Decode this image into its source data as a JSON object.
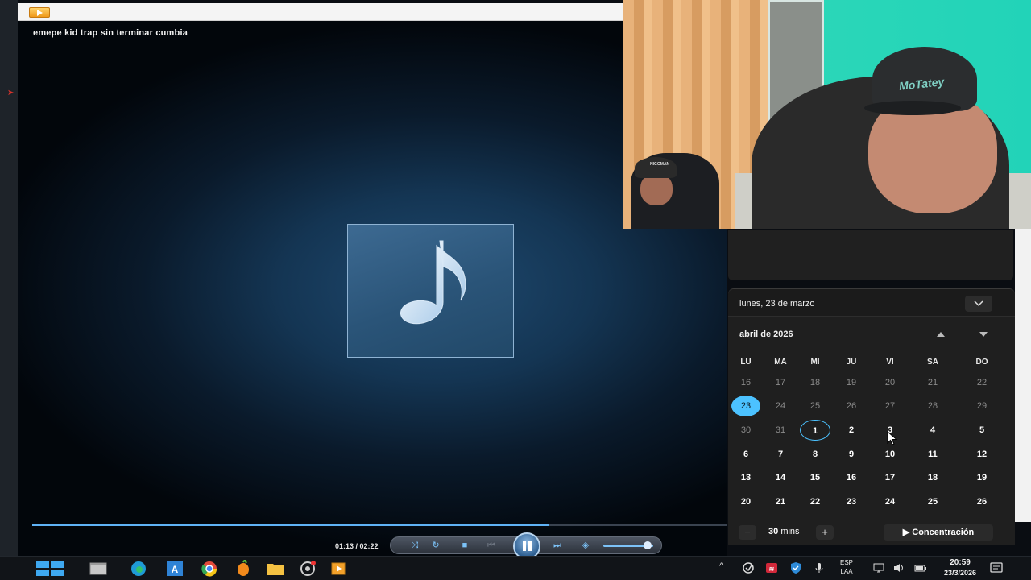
{
  "player": {
    "track_title": "emepe kid trap sin terminar cumbia",
    "time_readout": "01:13 / 02:22",
    "progress": 0.745,
    "volume": 0.85
  },
  "webcam": {
    "cap_text": "MoTatey",
    "small_cap_text": "NIGGMAN"
  },
  "calendar": {
    "full_date": "lunes, 23 de marzo",
    "month_label": "abril de 2026",
    "weekdays": [
      "LU",
      "MA",
      "MI",
      "JU",
      "VI",
      "SA",
      "DO"
    ],
    "rows": [
      [
        "16",
        "17",
        "18",
        "19",
        "20",
        "21",
        "22"
      ],
      [
        "23",
        "24",
        "25",
        "26",
        "27",
        "28",
        "29"
      ],
      [
        "30",
        "31",
        "1",
        "2",
        "3",
        "4",
        "5"
      ],
      [
        "6",
        "7",
        "8",
        "9",
        "10",
        "11",
        "12"
      ],
      [
        "13",
        "14",
        "15",
        "16",
        "17",
        "18",
        "19"
      ],
      [
        "20",
        "21",
        "22",
        "23",
        "24",
        "25",
        "26"
      ]
    ],
    "today": "23",
    "focus_minus": "−",
    "focus_plus": "+",
    "focus_value": "30",
    "focus_unit": "mins",
    "focus_button": "Concentración"
  },
  "taskbar": {
    "lang_top": "ESP",
    "lang_bottom": "LAA",
    "time": "20:59",
    "date": "23/3/2026",
    "tray_chevron": "^"
  },
  "colors": {
    "accent": "#4cc2ff",
    "seek_fill": "#5fb2f5"
  }
}
